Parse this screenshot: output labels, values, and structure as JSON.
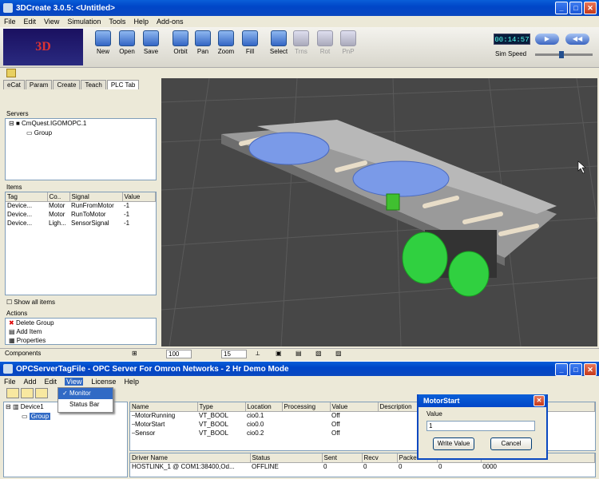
{
  "app": {
    "title": "3DCreate 3.0.5: <Untitled>",
    "menu": [
      "File",
      "Edit",
      "View",
      "Simulation",
      "Tools",
      "Help",
      "Add-ons"
    ],
    "toolbar": [
      "New",
      "Open",
      "Save",
      "Orbit",
      "Pan",
      "Zoom",
      "Fill",
      "Select",
      "Trns",
      "Rot",
      "PnP"
    ],
    "timer": "00:14:57",
    "sim_speed_label": "Sim Speed",
    "sim_speed_level": 0.45
  },
  "left": {
    "tabs": [
      "eCat",
      "Param",
      "Create",
      "Teach",
      "PLC Tab"
    ],
    "servers_label": "Servers",
    "server_tree": [
      "CmQuest.IGOMOPC.1",
      "Group"
    ],
    "items_label": "Items",
    "item_headers": [
      "Tag",
      "Co..",
      "Signal",
      "Value"
    ],
    "items": [
      [
        "Device...",
        "Motor",
        "RunFromMotor",
        "-1"
      ],
      [
        "Device...",
        "Motor",
        "RunToMotor",
        "-1"
      ],
      [
        "Device...",
        "Ligh...",
        "SensorSignal",
        "-1"
      ]
    ],
    "show_all": "Show all items",
    "actions_label": "Actions",
    "actions": [
      "Delete Group",
      "Add Item",
      "Properties"
    ]
  },
  "status": {
    "components": "Components",
    "field1": "100",
    "field2": "15"
  },
  "opc": {
    "title": "OPCServerTagFile - OPC Server For Omron Networks - 2 Hr Demo Mode",
    "menu": [
      "File",
      "Add",
      "Edit",
      "View",
      "License",
      "Help"
    ],
    "view_menu": [
      "Monitor",
      "Status Bar"
    ],
    "tree": [
      "Device1",
      "Group"
    ],
    "tag_headers": [
      "Name",
      "Type",
      "Location",
      "Processing",
      "Value",
      "Description"
    ],
    "tags": [
      [
        "MotorRunning",
        "VT_BOOL",
        "cio0.1",
        "",
        "Off"
      ],
      [
        "MotorStart",
        "VT_BOOL",
        "cio0.0",
        "",
        "Off"
      ],
      [
        "Sensor",
        "VT_BOOL",
        "cio0.2",
        "",
        "Off"
      ]
    ],
    "driver_headers": [
      "Driver Name",
      "Status",
      "Sent",
      "Recv",
      "Packets"
    ],
    "driver_row": [
      "HOSTLINK_1  @ COM1:38400,Od...",
      "OFFLINE",
      "0",
      "0",
      "0",
      "0",
      "0000"
    ]
  },
  "dialog": {
    "title": "MotorStart",
    "value_label": "Value",
    "value": "1",
    "write": "Write Value",
    "cancel": "Cancel"
  }
}
